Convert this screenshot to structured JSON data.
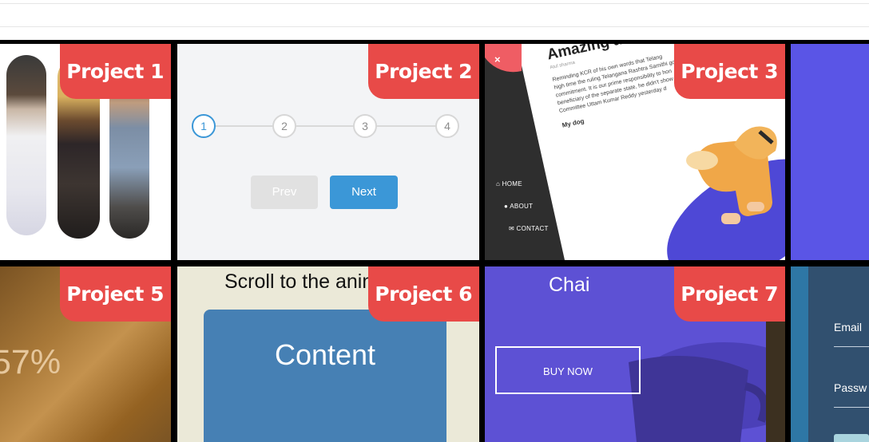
{
  "projects": [
    {
      "label": "Project 1"
    },
    {
      "label": "Project 2"
    },
    {
      "label": "Project 3"
    },
    {
      "label": "Project 5"
    },
    {
      "label": "Project 6"
    },
    {
      "label": "Project 7"
    }
  ],
  "stepper": {
    "steps": [
      "1",
      "2",
      "3",
      "4"
    ],
    "prev_label": "Prev",
    "next_label": "Next"
  },
  "blog_preview": {
    "heading": "Amazing a",
    "author": "Atul sharma",
    "body_lines": [
      "Reminding KCR of his own words that Telang",
      "high time the ruling Telangana Rashtra Samithi go",
      "commitment. It is our prime responsibility to hon",
      "beneficiary of the separate state, he didn't show",
      "Committee Uttam Kumar Reddy yesterday d"
    ],
    "subheading": "My dog",
    "close_symbol": "×",
    "menu": [
      "HOME",
      "ABOUT",
      "CONTACT"
    ]
  },
  "progress_preview": {
    "text": "57%"
  },
  "scroll_preview": {
    "title": "Scroll to the anim",
    "content": "Content"
  },
  "chai_preview": {
    "title": "Chai",
    "button": "BUY NOW"
  },
  "login_preview": {
    "email_label": "Email",
    "password_label": "Passw"
  },
  "colors": {
    "badge": "#e84a48",
    "stepper_active": "#3b97d7",
    "purple": "#5a55e6",
    "content_blue": "#4680b4"
  }
}
